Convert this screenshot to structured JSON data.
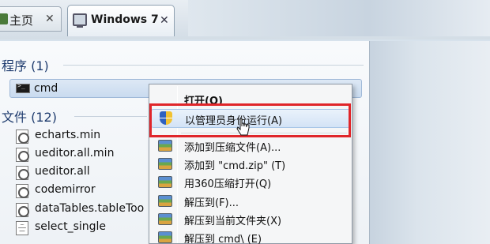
{
  "tabs": [
    {
      "label": "主页",
      "close": "✕"
    },
    {
      "label": "Windows 7",
      "close": "✕"
    }
  ],
  "sections": {
    "programs": "程序 (1)",
    "files": "文件 (12)"
  },
  "programs": [
    {
      "label": "cmd",
      "icon": "cmd-icon"
    }
  ],
  "files": [
    {
      "label": "echarts.min"
    },
    {
      "label": "ueditor.all.min"
    },
    {
      "label": "ueditor.all"
    },
    {
      "label": "codemirror"
    },
    {
      "label": "dataTables.tableToo"
    },
    {
      "label": "select_single"
    }
  ],
  "context_menu": {
    "items": [
      {
        "label": "打开(O)",
        "icon": "none"
      },
      {
        "label": "以管理员身份运行(A)",
        "icon": "shield-icon"
      },
      {
        "label": "添加到压缩文件(A)...",
        "icon": "archive-icon"
      },
      {
        "label": "添加到 \"cmd.zip\" (T)",
        "icon": "archive-icon"
      },
      {
        "label": "用360压缩打开(Q)",
        "icon": "archive-icon"
      },
      {
        "label": "解压到(F)...",
        "icon": "archive-icon"
      },
      {
        "label": "解压到当前文件夹(X)",
        "icon": "archive-icon"
      },
      {
        "label": "解压到 cmd\\ (E)",
        "icon": "archive-icon"
      }
    ]
  },
  "colors": {
    "highlight_border": "#e0262a",
    "section_heading": "#1e3b6e"
  }
}
